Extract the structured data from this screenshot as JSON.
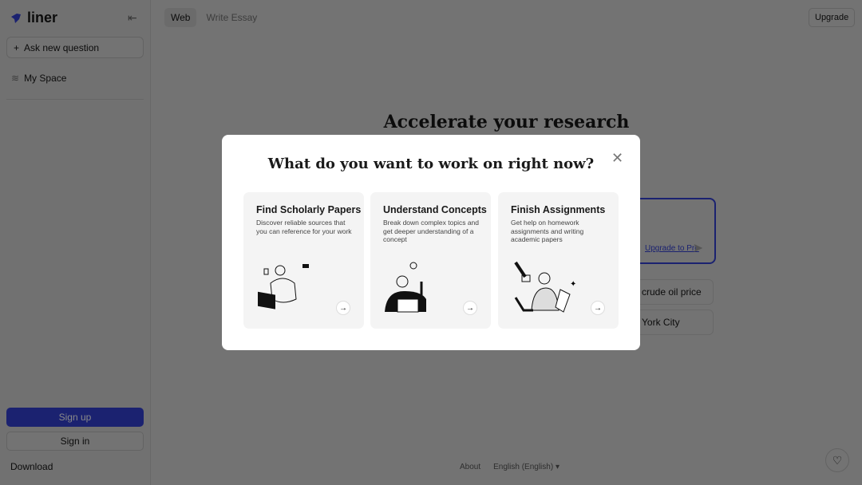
{
  "sidebar": {
    "logo": "liner",
    "ask_label": "Ask new question",
    "my_space": "My Space",
    "sign_up": "Sign up",
    "sign_in": "Sign in",
    "download": "Download"
  },
  "header": {
    "tabs": [
      {
        "label": "Web",
        "active": true
      },
      {
        "label": "Write Essay",
        "active": false
      }
    ],
    "upgrade": "Upgrade"
  },
  "main": {
    "hero": "Accelerate your research",
    "upgrade_link": "Upgrade to Pro",
    "suggestions": [
      "crude oil price",
      "York City"
    ]
  },
  "footer": {
    "about": "About",
    "language": "English (English)"
  },
  "modal": {
    "title": "What do you want to work on right now?",
    "cards": [
      {
        "title": "Find Scholarly Papers",
        "desc": "Discover reliable sources that you can reference for your work"
      },
      {
        "title": "Understand Concepts",
        "desc": "Break down complex topics and get deeper understanding of a concept"
      },
      {
        "title": "Finish Assignments",
        "desc": "Get help on homework assignments and writing academic papers"
      }
    ]
  },
  "colors": {
    "brand": "#2a36c8"
  }
}
